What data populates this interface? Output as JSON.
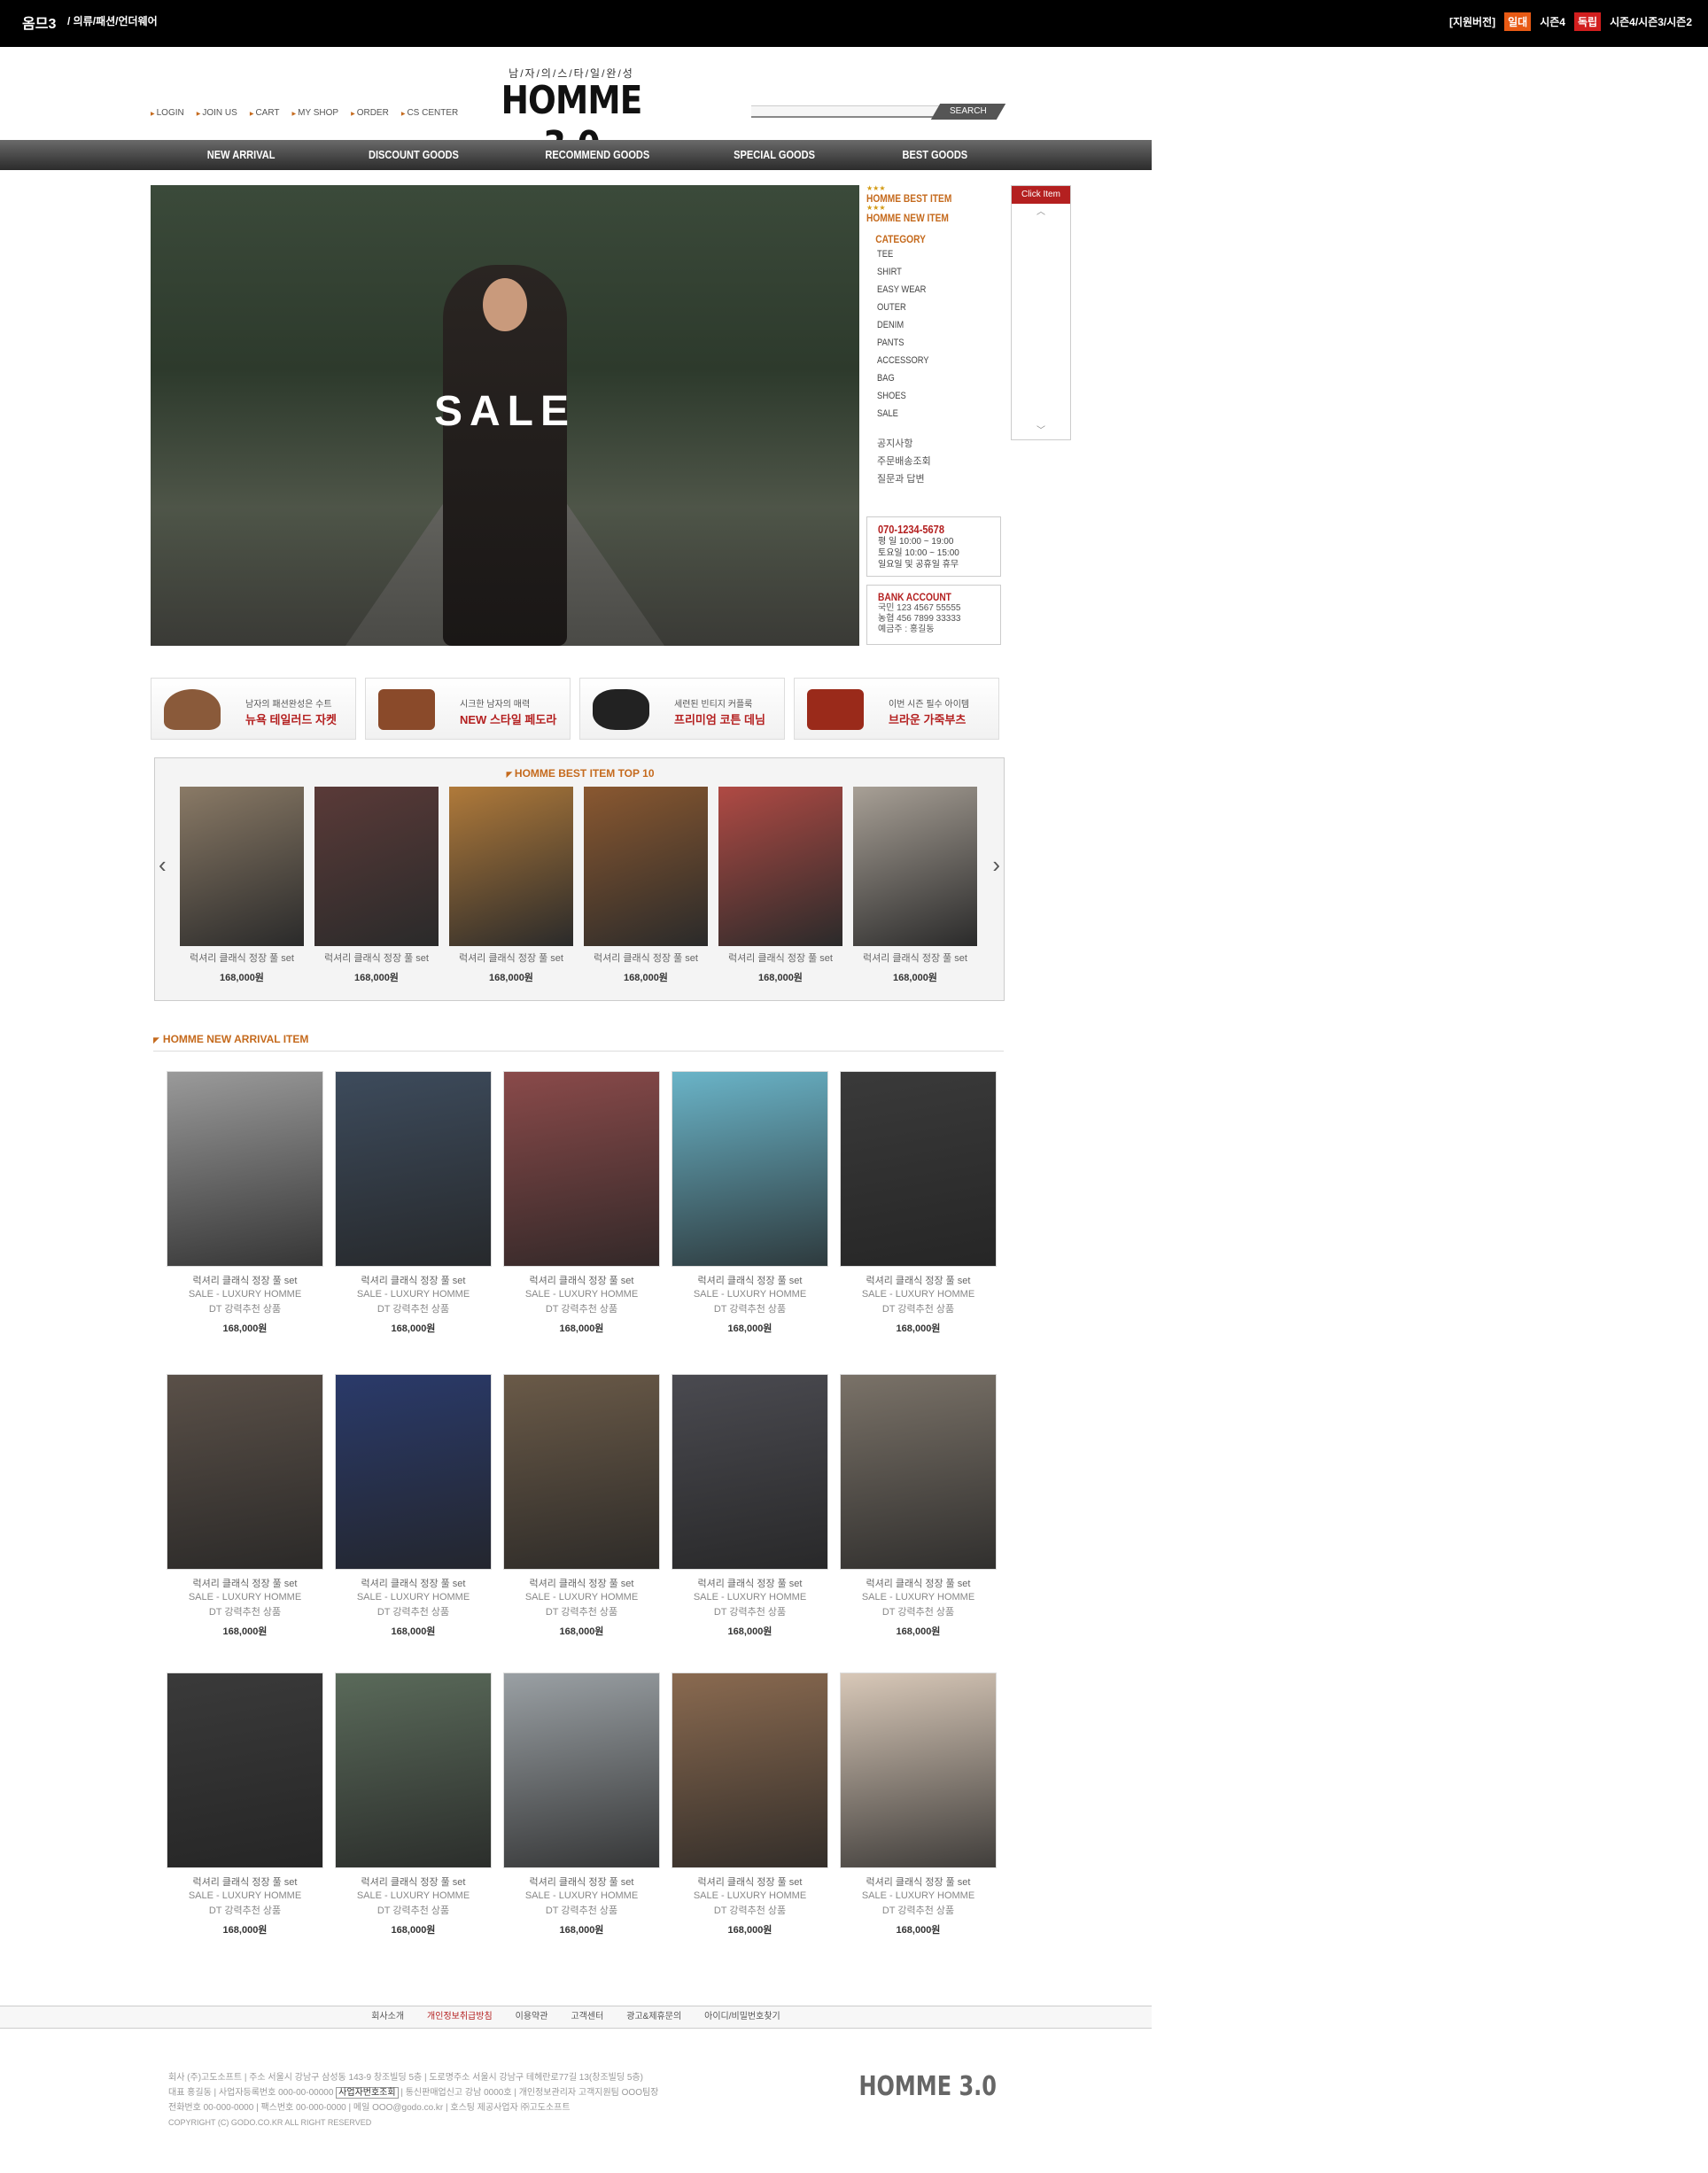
{
  "topbar": {
    "brand": "옴므3",
    "category": "/ 의류/패션/언더웨어",
    "right": [
      {
        "text": "[지원버전]",
        "bg": ""
      },
      {
        "text": "일대",
        "bg": "#e85a14"
      },
      {
        "text": "시즌4",
        "bg": ""
      },
      {
        "text": "독립",
        "bg": "#d21e1e"
      },
      {
        "text": "시즌4/시즌3/시즌2",
        "bg": ""
      }
    ]
  },
  "header": {
    "links": [
      "LOGIN",
      "JOIN US",
      "CART",
      "MY SHOP",
      "ORDER",
      "CS CENTER"
    ],
    "logo_sub": "남/자/의/스/타/일/완/성",
    "logo": "HOMME 3.0",
    "search_button": "SEARCH"
  },
  "nav": [
    "NEW ARRIVAL",
    "DISCOUNT GOODS",
    "RECOMMEND GOODS",
    "SPECIAL GOODS",
    "BEST GOODS"
  ],
  "hero": {
    "text": "SALE"
  },
  "side": {
    "best": "HOMME BEST ITEM",
    "new": "HOMME NEW ITEM",
    "category_label": "CATEGORY",
    "categories": [
      "TEE",
      "SHIRT",
      "EASY WEAR",
      "OUTER",
      "DENIM",
      "PANTS",
      "ACCESSORY",
      "BAG",
      "SHOES",
      "SALE"
    ],
    "info": [
      "공지사항",
      "주문배송조회",
      "질문과 답변"
    ],
    "cs": {
      "phone": "070-1234-5678",
      "lines": [
        "평  일 10:00 ~ 19:00",
        "토요일 10:00 ~ 15:00",
        "일요일 및 공휴일 휴무"
      ]
    },
    "bank": {
      "title": "BANK ACCOUNT",
      "lines": [
        "국민 123 4567 55555",
        "농협 456 7899 33333",
        "예금주 : 홍길동"
      ]
    }
  },
  "quick": {
    "label": "Click Item"
  },
  "banners": [
    {
      "l1": "남자의 패션완성은 수트",
      "l2": "뉴욕 테일러드 자켓",
      "icon": "hat-icon"
    },
    {
      "l1": "시크한 남자의 매력",
      "l2": "NEW 스타일 페도라",
      "icon": "bag-icon"
    },
    {
      "l1": "세련된 빈티지 커플룩",
      "l2": "프리미엄 코튼 데님",
      "icon": "sunglasses-icon"
    },
    {
      "l1": "이번 시즌 필수 아이템",
      "l2": "브라운 가죽부츠",
      "icon": "wallet-icon"
    }
  ],
  "best_section": {
    "title": "HOMME BEST ITEM TOP 10",
    "items": [
      {
        "name": "럭셔리 클래식 정장 풀 set",
        "price": "168,000원",
        "color": "#8a7a66"
      },
      {
        "name": "럭셔리 클래식 정장 풀 set",
        "price": "168,000원",
        "color": "#5a3a38"
      },
      {
        "name": "럭셔리 클래식 정장 풀 set",
        "price": "168,000원",
        "color": "#b07a3a"
      },
      {
        "name": "럭셔리 클래식 정장 풀 set",
        "price": "168,000원",
        "color": "#8a5830"
      },
      {
        "name": "럭셔리 클래식 정장 풀 set",
        "price": "168,000원",
        "color": "#b04a44"
      },
      {
        "name": "럭셔리 클래식 정장 풀 set",
        "price": "168,000원",
        "color": "#a8a096"
      }
    ]
  },
  "new_section": {
    "title": "HOMME NEW ARRIVAL ITEM",
    "line2": "SALE - LUXURY HOMME",
    "line3": "DT 강력추천 상품",
    "name": "럭셔리 클래식 정장 풀 set",
    "price": "168,000원",
    "colors": [
      [
        "#9a9a9a",
        "#3d4b5c",
        "#8a4a4a",
        "#6ab4c8",
        "#3a3a3a"
      ],
      [
        "#5a5048",
        "#2a3a6a",
        "#6a5a48",
        "#4a4a50",
        "#7a7268"
      ],
      [
        "#3a3a3a",
        "#5a6a5a",
        "#9aa0a4",
        "#8a6a50",
        "#d8c8b8"
      ]
    ]
  },
  "footer": {
    "links": [
      "회사소개",
      "개인정보취급방침",
      "이용약관",
      "고객센터",
      "광고&제휴문의",
      "아이디/비밀번호찾기"
    ],
    "lines": [
      "회사 (주)고도소프트  |  주소 서울시 강남구 삼성동 143-9 창조빌딩 5층  |  도로명주소 서울시 강남구 테헤란로77길 13(창조빌딩 5층)",
      "대표 홍길동  |  사업자등록번호 000-00-00000",
      "전화번호 00-000-0000  |  팩스번호 00-000-0000  |  메일 OOO@godo.co.kr  |  호스팅 제공사업자 ㈜고도소프트",
      "COPYRIGHT (C) GODO.CO.KR ALL RIGHT RESERVED"
    ],
    "biz_button": "사업자번호조회",
    "line2_tail": "  |  통신판매업신고 강남 0000호  |  개인정보관리자 고객지원팀 OOO팀장",
    "logo": "HOMME 3.0"
  }
}
